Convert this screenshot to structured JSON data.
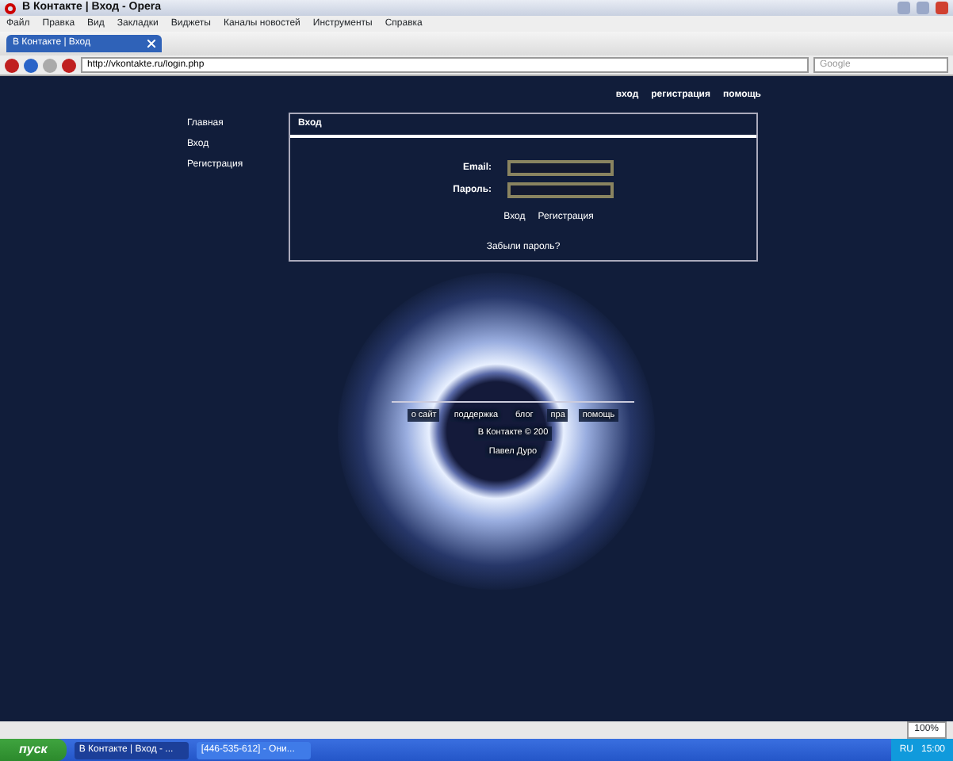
{
  "window": {
    "title": "В Контакте | Вход - Opera"
  },
  "menu": [
    "Файл",
    "Правка",
    "Вид",
    "Закладки",
    "Виджеты",
    "Каналы новостей",
    "Инструменты",
    "Справка"
  ],
  "tabs": [
    {
      "label": "В Контакте | Вход",
      "selected": true
    }
  ],
  "address_bar": {
    "value": "http://vkontakte.ru/login.php"
  },
  "search": {
    "placeholder": "Google"
  },
  "page": {
    "top_links": [
      "вход",
      "регистрация",
      "помощь"
    ],
    "sidebar": {
      "items": [
        "Главная",
        "Вход",
        "Регистрация"
      ]
    },
    "login_panel": {
      "title": "Вход",
      "fields": [
        {
          "label": "Email:"
        },
        {
          "label": "Пароль:"
        }
      ],
      "links": [
        "Вход",
        "Регистрация"
      ],
      "forgot": "Забыли пароль?"
    },
    "footer": {
      "links": [
        "о сайт",
        "поддержка",
        "блог",
        "пра",
        "помощь"
      ],
      "copyright": "В Контакте © 200",
      "author": "Павел Дуро"
    }
  },
  "status_bar": {
    "zoom": "100%"
  },
  "taskbar": {
    "start": "пуск",
    "tasks": [
      {
        "label": "В Контакте | Вход - ...",
        "selected": true
      },
      {
        "label": "[446-535-612] - Они...",
        "selected": false
      }
    ],
    "lang": "RU",
    "clock": "15:00"
  }
}
